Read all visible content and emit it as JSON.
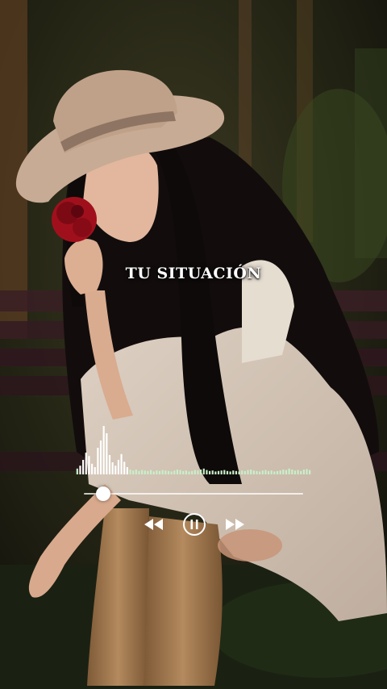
{
  "caption": {
    "text": "TU SITUACIÓN"
  },
  "player": {
    "progress": 0.09,
    "state": "playing",
    "controls": {
      "rewind_icon": "rewind-icon",
      "play_pause_icon": "pause-icon",
      "forward_icon": "fast-forward-icon"
    },
    "visualizer_levels": [
      0.12,
      0.18,
      0.3,
      0.45,
      0.38,
      0.22,
      0.15,
      0.55,
      0.7,
      1.0,
      0.85,
      0.4,
      0.25,
      0.18,
      0.3,
      0.42,
      0.26,
      0.15,
      0.1,
      0.08,
      0.1,
      0.07,
      0.09,
      0.08,
      0.07,
      0.09,
      0.06,
      0.08,
      0.07,
      0.09,
      0.08,
      0.07,
      0.06,
      0.08,
      0.1,
      0.09,
      0.07,
      0.08,
      0.06,
      0.07,
      0.09,
      0.08,
      0.1,
      0.12,
      0.09,
      0.07,
      0.08,
      0.06,
      0.07,
      0.08,
      0.09,
      0.07,
      0.06,
      0.08,
      0.07,
      0.06,
      0.08,
      0.07,
      0.09,
      0.1,
      0.08,
      0.07,
      0.06,
      0.08,
      0.09,
      0.07,
      0.08,
      0.06,
      0.07,
      0.08,
      0.1,
      0.09,
      0.12,
      0.1,
      0.08,
      0.09,
      0.07,
      0.1,
      0.11,
      0.09
    ]
  },
  "colors": {
    "visualizer_active": "#ffffff",
    "visualizer_idle": "#c8f0c8",
    "hat": "#c8ab94",
    "rose": "#a0101c",
    "hair": "#120d0c"
  },
  "background": {
    "description_icon": "photo-background"
  }
}
